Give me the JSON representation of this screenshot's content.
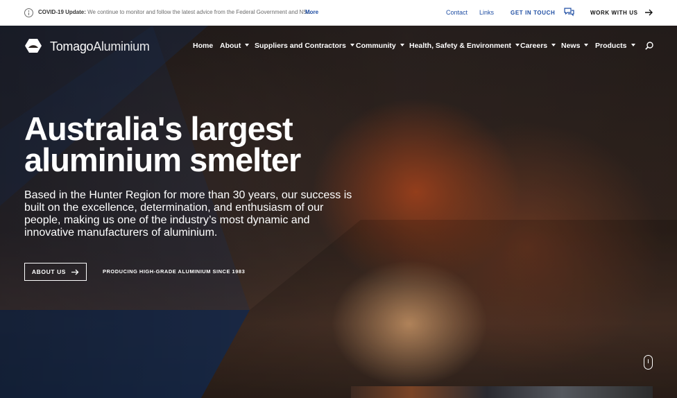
{
  "alert": {
    "prefix": "COVID-19 Update:",
    "message": "We continue to monitor and follow the latest advice from the Federal Government and NS…",
    "more_label": "More"
  },
  "top_links": {
    "contact": "Contact",
    "links": "Links",
    "get_in_touch": "GET IN TOUCH",
    "work_with_us": "WORK WITH US"
  },
  "brand": {
    "name_bold": "Tomago",
    "name_light": "Aluminium"
  },
  "nav": {
    "home": "Home",
    "about": "About",
    "suppliers": "Suppliers and Contractors",
    "community": "Community",
    "hse": "Health, Safety & Environment",
    "careers": "Careers",
    "news": "News",
    "products": "Products"
  },
  "hero": {
    "title": "Australia's largest aluminium smelter",
    "description": "Based in the Hunter Region for more than 30 years, our success is built on the excellence, determination, and enthusiasm of our people, making us one of the industry’s most dynamic and innovative manufacturers of aluminium.",
    "cta_label": "ABOUT US",
    "tagline": "PRODUCING HIGH-GRADE ALUMINIUM SINCE 1983"
  },
  "colors": {
    "link_blue": "#1f4ea3",
    "brand_blue": "#1e3a6e"
  },
  "icons": [
    "info-icon",
    "chat-icon",
    "arrow-right-icon",
    "search-icon",
    "chevron-down-icon",
    "scroll-mouse-icon"
  ]
}
